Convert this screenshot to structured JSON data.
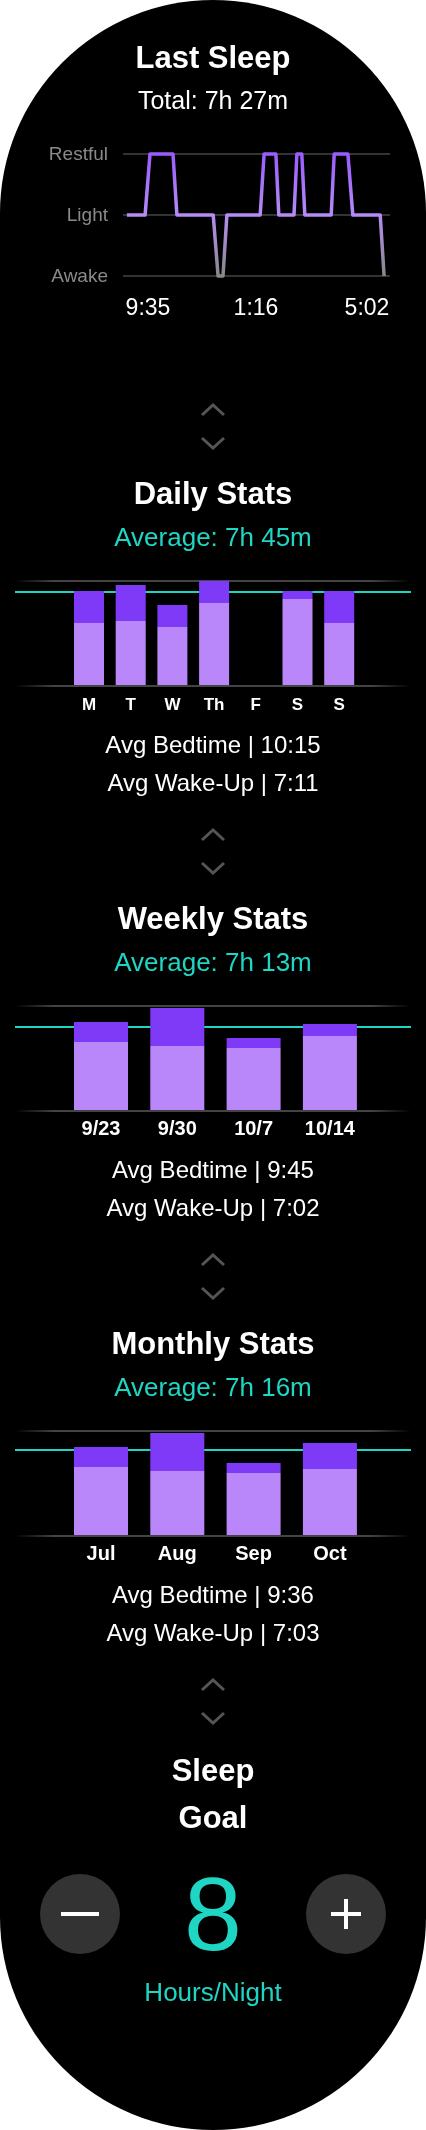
{
  "last_sleep": {
    "title": "Last Sleep",
    "total": "Total: 7h 27m",
    "stage_labels": [
      "Restful",
      "Light",
      "Awake"
    ],
    "time_labels": [
      "9:35",
      "1:16",
      "5:02"
    ]
  },
  "stats": [
    {
      "title": "Daily Stats",
      "average": "Average: 7h 45m",
      "labels": [
        "M",
        "T",
        "W",
        "Th",
        "F",
        "S",
        "S"
      ],
      "bedtime": "Avg Bedtime | 10:15",
      "wakeup": "Avg Wake-Up | 7:11"
    },
    {
      "title": "Weekly Stats",
      "average": "Average: 7h 13m",
      "labels": [
        "9/23",
        "9/30",
        "10/7",
        "10/14"
      ],
      "bedtime": "Avg Bedtime | 9:45",
      "wakeup": "Avg Wake-Up | 7:02"
    },
    {
      "title": "Monthly Stats",
      "average": "Average: 7h 16m",
      "labels": [
        "Jul",
        "Aug",
        "Sep",
        "Oct"
      ],
      "bedtime": "Avg Bedtime | 9:36",
      "wakeup": "Avg Wake-Up | 7:03"
    }
  ],
  "sleep_goal": {
    "title": "Sleep Goal",
    "value": "8",
    "unit": "Hours/Night"
  }
}
